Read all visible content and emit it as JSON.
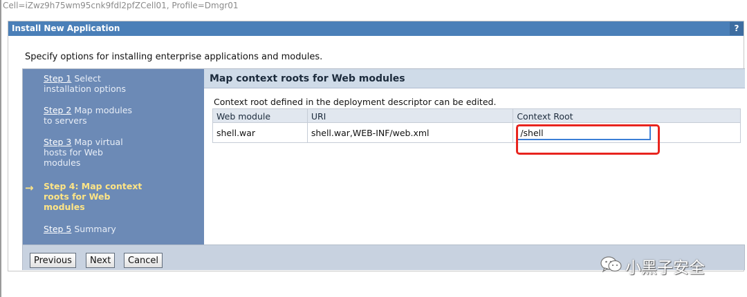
{
  "cell_info": "Cell=iZwz9h75wm95cnk9fdl2pfZCell01, Profile=Dmgr01",
  "window": {
    "title": "Install New Application",
    "help_label": "?"
  },
  "intro_text": "Specify options for installing enterprise applications and modules.",
  "steps": [
    {
      "link": "Step 1",
      "label_line1": " Select",
      "label_line2": "installation options"
    },
    {
      "link": "Step 2",
      "label_line1": " Map modules",
      "label_line2": "to servers"
    },
    {
      "link": "Step 3",
      "label_line1": " Map virtual",
      "label_line2": "hosts for Web",
      "label_line3": "modules"
    },
    {
      "current": "Step 4: Map context",
      "current_line2": "roots for Web",
      "current_line3": "modules",
      "marker": "→"
    },
    {
      "link": "Step 5",
      "label_line1": " Summary"
    }
  ],
  "content": {
    "title": "Map context roots for Web modules",
    "description": "Context root defined in the deployment descriptor can be edited.",
    "table": {
      "headers": [
        "Web module",
        "URI",
        "Context Root"
      ],
      "rows": [
        {
          "web_module": "shell.war",
          "uri": "shell.war,WEB-INF/web.xml",
          "context_root": "/shell"
        }
      ]
    }
  },
  "buttons": {
    "previous": "Previous",
    "next": "Next",
    "cancel": "Cancel"
  },
  "watermark": {
    "icon": "wechat-icon",
    "text": "小黑子安全"
  },
  "colors": {
    "titlebar": "#4a7fb8",
    "steps_panel": "#6c8ab6",
    "current_step": "#ffe585",
    "highlight_box": "#e8241e",
    "input_focus": "#3b7fd6"
  }
}
